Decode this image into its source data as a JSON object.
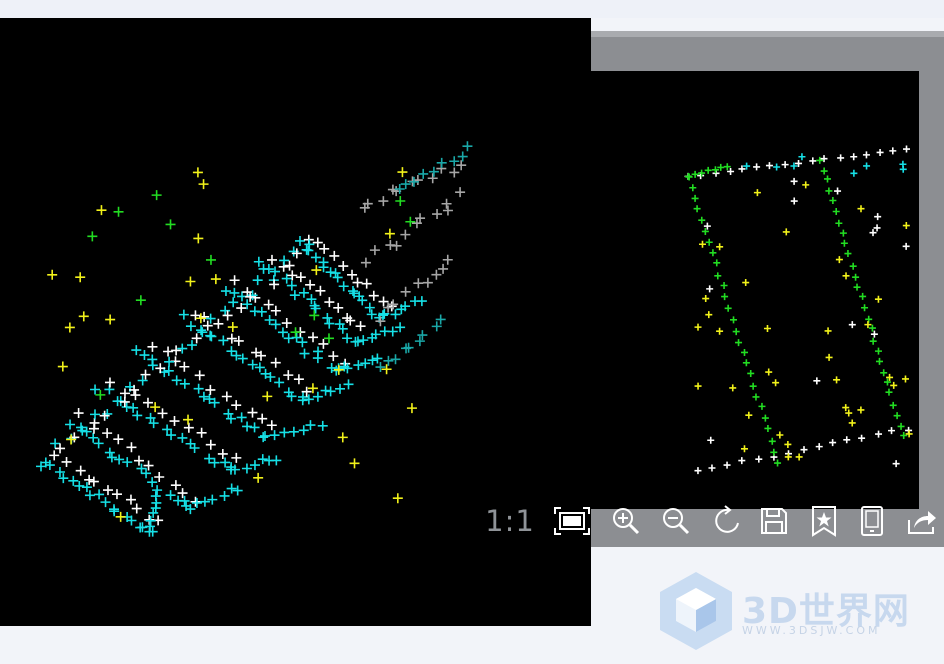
{
  "viewer": {
    "zoom_label": "1:1",
    "toolbar": [
      {
        "name": "fit-window-icon",
        "title": "Fit to window"
      },
      {
        "name": "zoom-in-icon",
        "title": "Zoom in"
      },
      {
        "name": "zoom-out-icon",
        "title": "Zoom out"
      },
      {
        "name": "rotate-icon",
        "title": "Rotate"
      },
      {
        "name": "save-icon",
        "title": "Save"
      },
      {
        "name": "bookmark-star-icon",
        "title": "Favorite"
      },
      {
        "name": "phone-icon",
        "title": "Send to phone"
      },
      {
        "name": "share-icon",
        "title": "Share"
      }
    ]
  },
  "marker_colors": {
    "cyan": "#16e0e6",
    "white": "#ffffff",
    "yellow": "#f2f21a",
    "gray": "#a6a6a6",
    "teal": "#1aa8a8",
    "green": "#22dd22"
  },
  "watermark": {
    "brand": "3D世界网",
    "url": "WWW.3DSJW.COM"
  }
}
